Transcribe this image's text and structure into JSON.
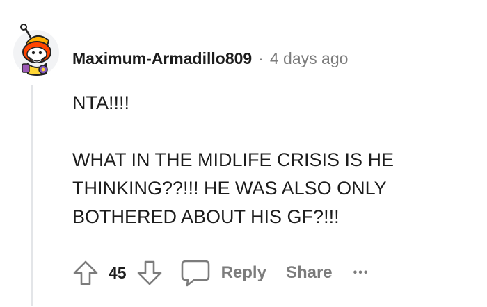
{
  "comment": {
    "username": "Maximum-Armadillo809",
    "separator": "·",
    "timestamp": "4 days ago",
    "paragraphs": [
      "NTA!!!!",
      "WHAT IN THE MIDLIFE CRISIS IS HE THINKING??!!! HE WAS ALSO ONLY BOTHERED ABOUT HIS GF?!!!"
    ]
  },
  "actions": {
    "vote_count": "45",
    "reply_label": "Reply",
    "share_label": "Share",
    "more_label": "•••"
  },
  "colors": {
    "text": "#1c1c1c",
    "muted": "#7c7c7c",
    "thread_line": "#e3e5e8",
    "avatar_orange": "#ff4500"
  },
  "icons": [
    "avatar-snoo",
    "upvote-arrow-icon",
    "downvote-arrow-icon",
    "comment-bubble-icon",
    "more-options-icon"
  ]
}
